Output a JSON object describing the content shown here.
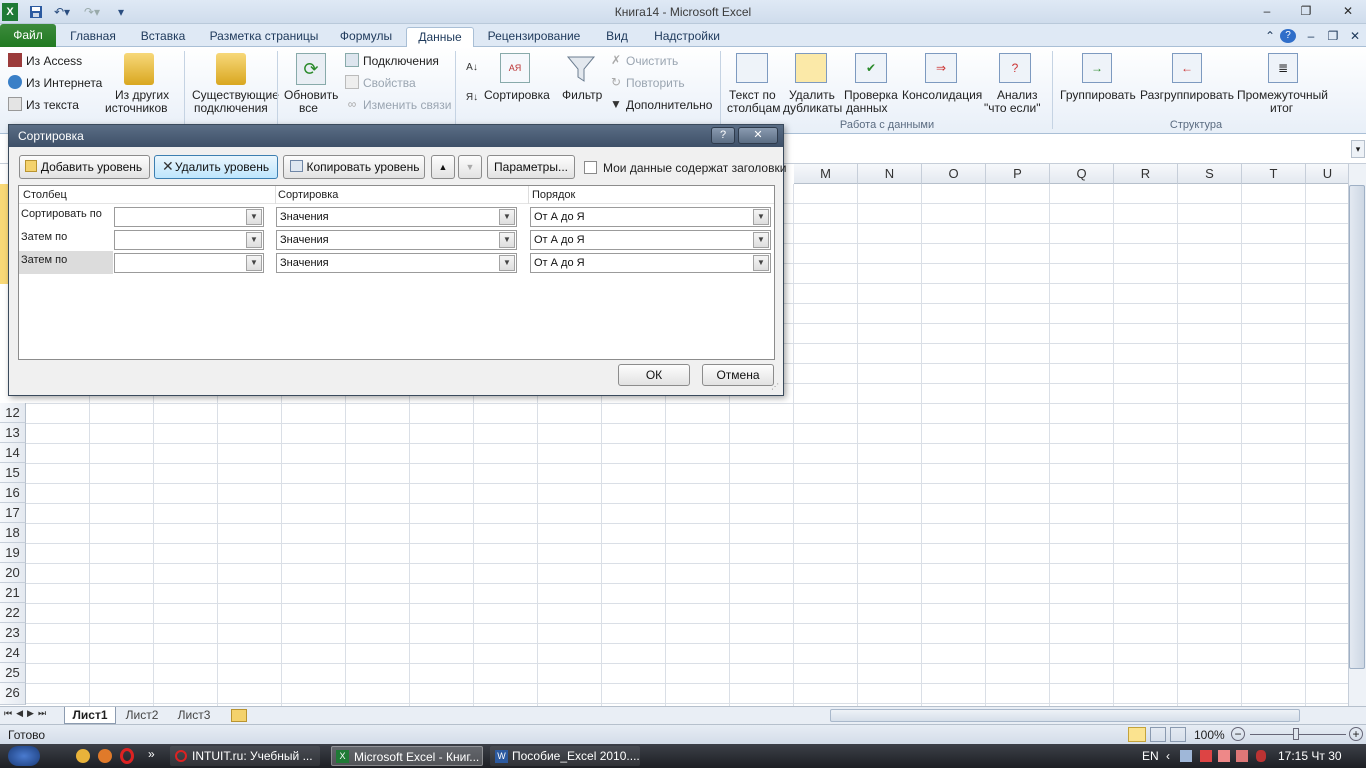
{
  "window": {
    "title": "Книга14  -  Microsoft Excel",
    "controls": {
      "minimize": "–",
      "restore": "❐",
      "close": "✕"
    }
  },
  "ribbon_tabs": [
    {
      "label": "Файл"
    },
    {
      "label": "Главная"
    },
    {
      "label": "Вставка"
    },
    {
      "label": "Разметка страницы"
    },
    {
      "label": "Формулы"
    },
    {
      "label": "Данные"
    },
    {
      "label": "Рецензирование"
    },
    {
      "label": "Вид"
    },
    {
      "label": "Надстройки"
    }
  ],
  "active_tab": "Данные",
  "ribbon": {
    "external": {
      "access": "Из Access",
      "web": "Из Интернета",
      "text": "Из текста",
      "other_line1": "Из других",
      "other_line2": "источников"
    },
    "existing": {
      "line1": "Существующие",
      "line2": "подключения"
    },
    "refresh": {
      "line1": "Обновить",
      "line2": "все"
    },
    "connections": {
      "connections": "Подключения",
      "properties": "Свойства",
      "edit_links": "Изменить связи"
    },
    "sort_filter": {
      "sort": "Сортировка",
      "filter": "Фильтр",
      "clear": "Очистить",
      "reapply": "Повторить",
      "advanced": "Дополнительно"
    },
    "data_tools": {
      "text_to_cols_1": "Текст по",
      "text_to_cols_2": "столбцам",
      "remove_dup_1": "Удалить",
      "remove_dup_2": "дубликаты",
      "validation_1": "Проверка",
      "validation_2": "данных",
      "consolidate": "Консолидация",
      "whatif_1": "Анализ",
      "whatif_2": "\"что если\"",
      "group_label": "Работа с данными"
    },
    "outline": {
      "group": "Группировать",
      "ungroup": "Разгруппировать",
      "subtotal_1": "Промежуточный",
      "subtotal_2": "итог",
      "group_label": "Структура"
    }
  },
  "columns": [
    "M",
    "N",
    "O",
    "P",
    "Q",
    "R",
    "S",
    "T",
    "U"
  ],
  "rows": [
    "12",
    "13",
    "14",
    "15",
    "16",
    "17",
    "18",
    "19",
    "20",
    "21",
    "22",
    "23",
    "24",
    "25",
    "26"
  ],
  "dialog": {
    "title": "Сортировка",
    "help": "?",
    "close": "✕",
    "buttons": {
      "add_level": "Добавить уровень",
      "delete_level": "Удалить уровень",
      "copy_level": "Копировать уровень",
      "options": "Параметры...",
      "ok": "ОК",
      "cancel": "Отмена"
    },
    "header_checkbox": "Мои данные содержат заголовки",
    "headers": {
      "column": "Столбец",
      "sort_on": "Сортировка",
      "order": "Порядок"
    },
    "levels": [
      {
        "label": "Сортировать по",
        "column": "",
        "sort_on": "Значения",
        "order": "От А до Я"
      },
      {
        "label": "Затем по",
        "column": "",
        "sort_on": "Значения",
        "order": "От А до Я"
      },
      {
        "label": "Затем по",
        "column": "",
        "sort_on": "Значения",
        "order": "От А до Я"
      }
    ]
  },
  "sheets": [
    "Лист1",
    "Лист2",
    "Лист3"
  ],
  "active_sheet": "Лист1",
  "status": {
    "ready": "Готово",
    "zoom": "100%"
  },
  "taskbar": {
    "items": [
      {
        "label": "INTUIT.ru: Учебный ..."
      },
      {
        "label": "Microsoft Excel - Книг..."
      },
      {
        "label": "Пособие_Excel 2010...."
      }
    ],
    "lang": "EN",
    "clock": "17:15 Чт 30"
  }
}
